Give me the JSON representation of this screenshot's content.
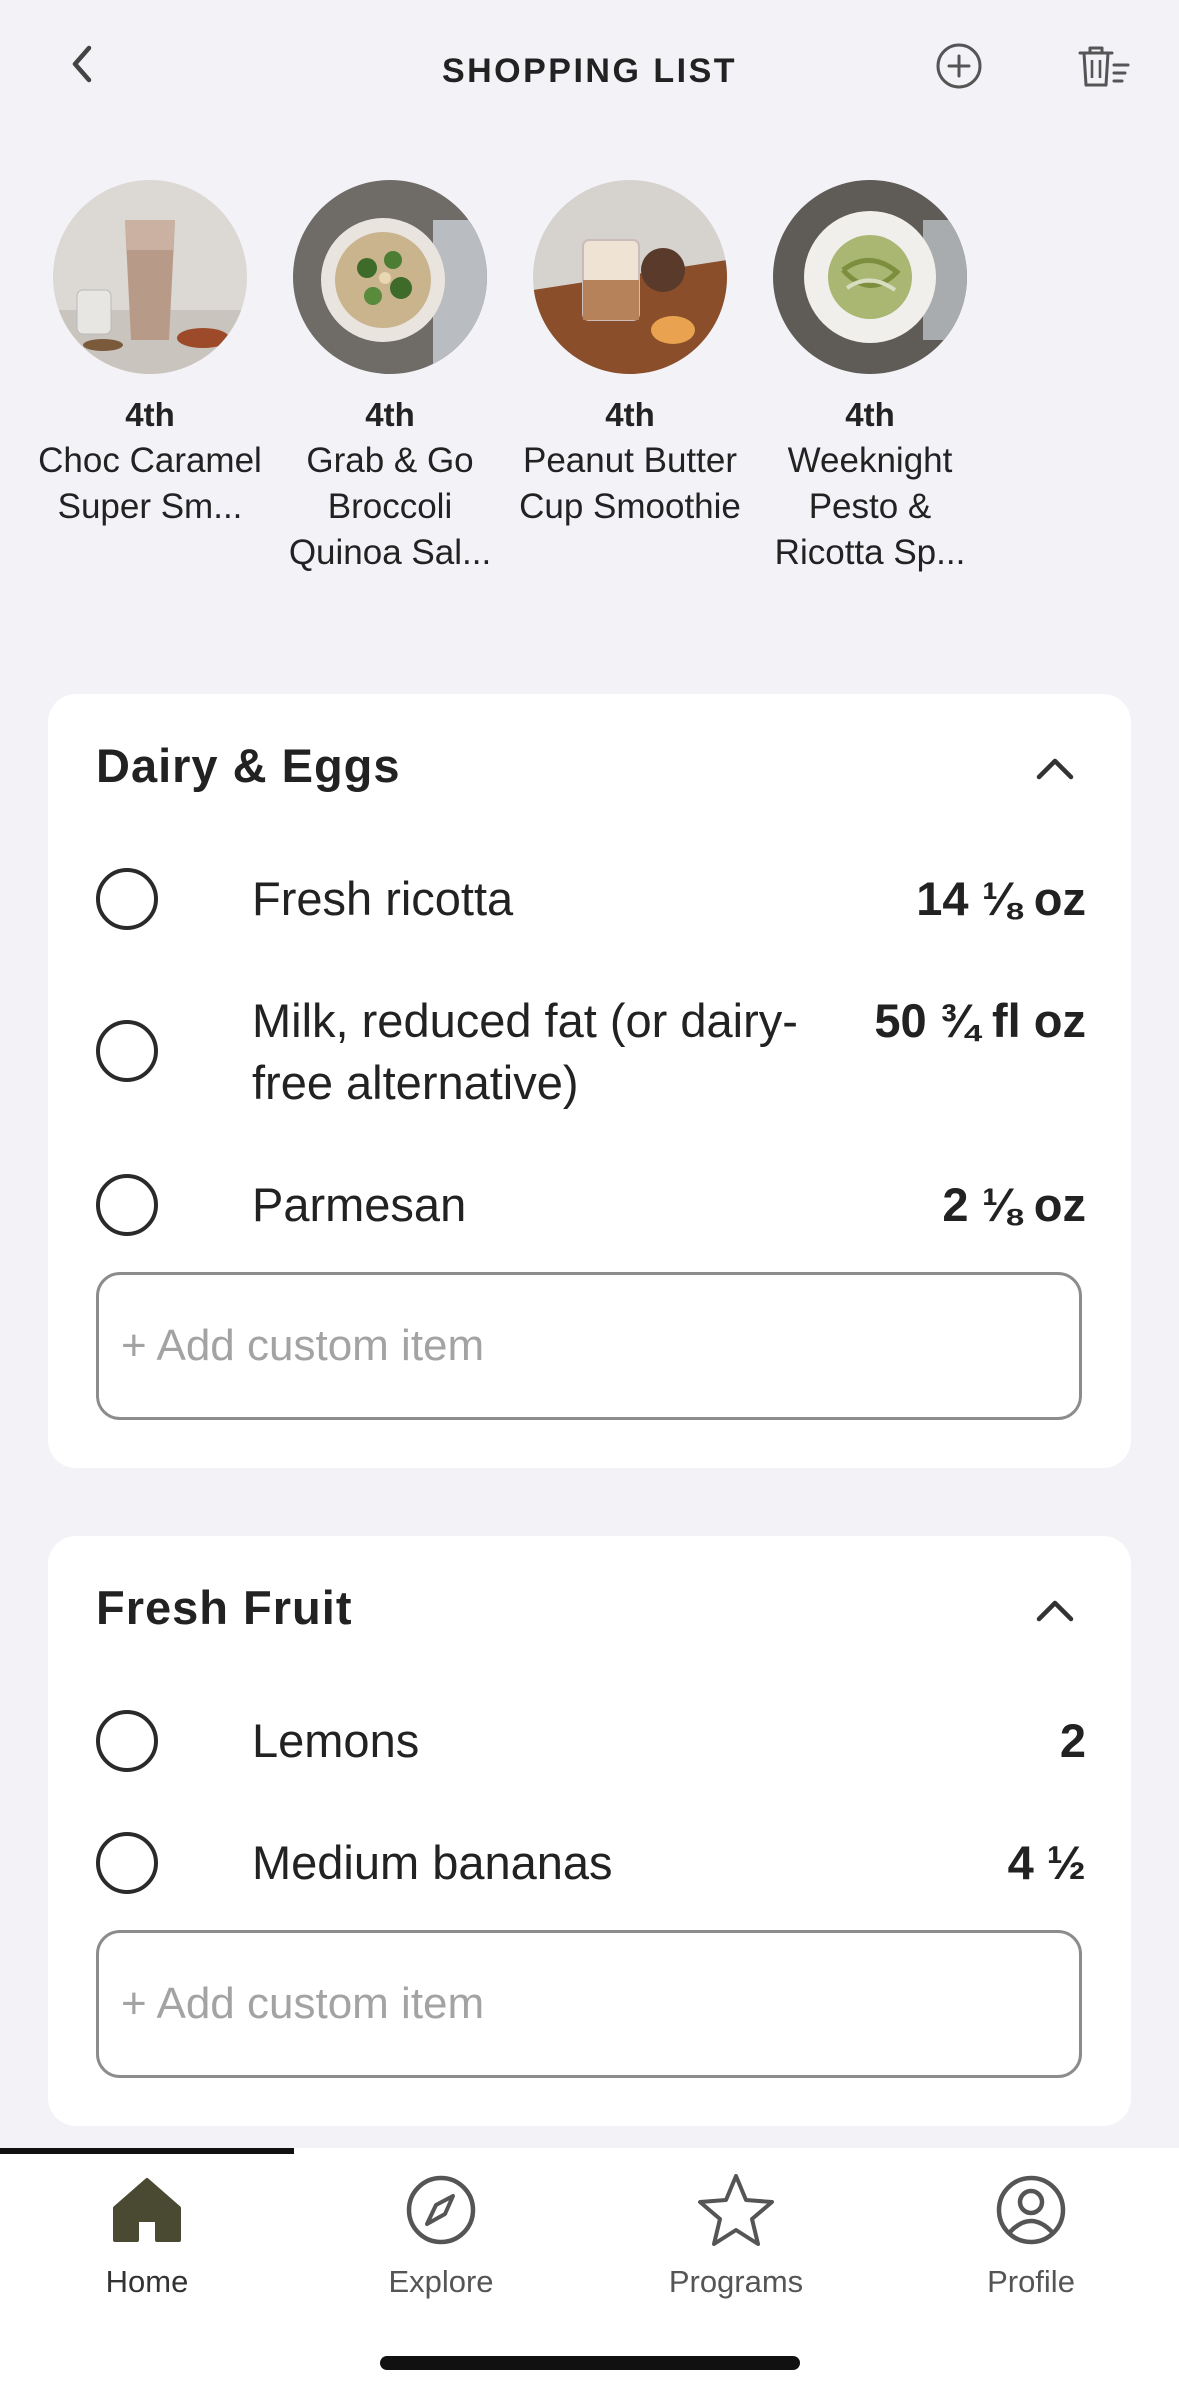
{
  "header": {
    "title": "SHOPPING LIST"
  },
  "recipes": [
    {
      "day": "4th",
      "name": "Choc Caramel Super Sm..."
    },
    {
      "day": "4th",
      "name": "Grab & Go Broccoli Quinoa Sal..."
    },
    {
      "day": "4th",
      "name": "Peanut Butter Cup Smoothie"
    },
    {
      "day": "4th",
      "name": "Weeknight Pesto & Ricotta Sp..."
    }
  ],
  "sections": [
    {
      "title": "Dairy & Eggs",
      "items": [
        {
          "name": "Fresh ricotta",
          "qty": "14 ⅛  oz"
        },
        {
          "name": "Milk, reduced fat (or dairy-free alternative)",
          "qty": "50 ¾  fl oz"
        },
        {
          "name": "Parmesan",
          "qty": "2 ⅛  oz"
        }
      ],
      "custom_placeholder": "+ Add custom item"
    },
    {
      "title": "Fresh Fruit",
      "items": [
        {
          "name": "Lemons",
          "qty": "2"
        },
        {
          "name": "Medium bananas",
          "qty": "4 ½"
        }
      ],
      "custom_placeholder": "+ Add custom item"
    }
  ],
  "tabs": [
    {
      "label": "Home",
      "icon": "home-icon",
      "active": true
    },
    {
      "label": "Explore",
      "icon": "compass-icon",
      "active": false
    },
    {
      "label": "Programs",
      "icon": "star-icon",
      "active": false
    },
    {
      "label": "Profile",
      "icon": "profile-icon",
      "active": false
    }
  ],
  "colors": {
    "background": "#f2f2f7",
    "card": "#ffffff",
    "active_tab": "#4a4a33"
  }
}
